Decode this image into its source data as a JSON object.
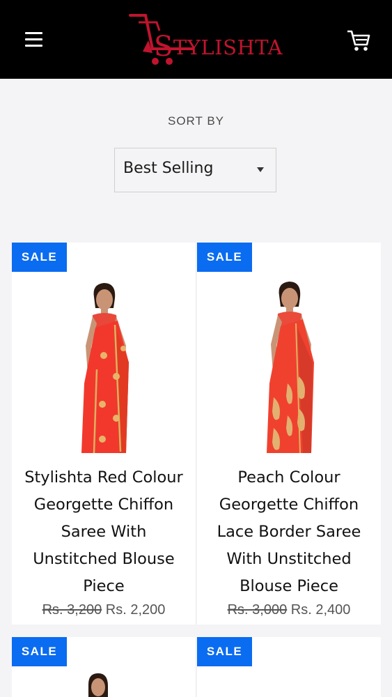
{
  "header": {
    "logo_text_first": "S",
    "logo_text_rest": "TYLISHTA",
    "brand_color": "#c0142e",
    "menu_icon": "hamburger-menu-icon",
    "cart_icon": "shopping-cart-icon"
  },
  "sort": {
    "label": "SORT BY",
    "selected": "Best Selling"
  },
  "badge_color": "#0a6cf0",
  "products": [
    {
      "badge": "SALE",
      "title": "Stylishta Red Colour Georgette Chiffon Saree With Unstitched Blouse Piece",
      "price_old": "Rs. 3,200",
      "price_new": "Rs. 2,200"
    },
    {
      "badge": "SALE",
      "title": "Peach Colour Georgette Chiffon Lace Border Saree With Unstitched Blouse Piece",
      "price_old": "Rs. 3,000",
      "price_new": "Rs. 2,400"
    },
    {
      "badge": "SALE"
    },
    {
      "badge": "SALE"
    }
  ]
}
